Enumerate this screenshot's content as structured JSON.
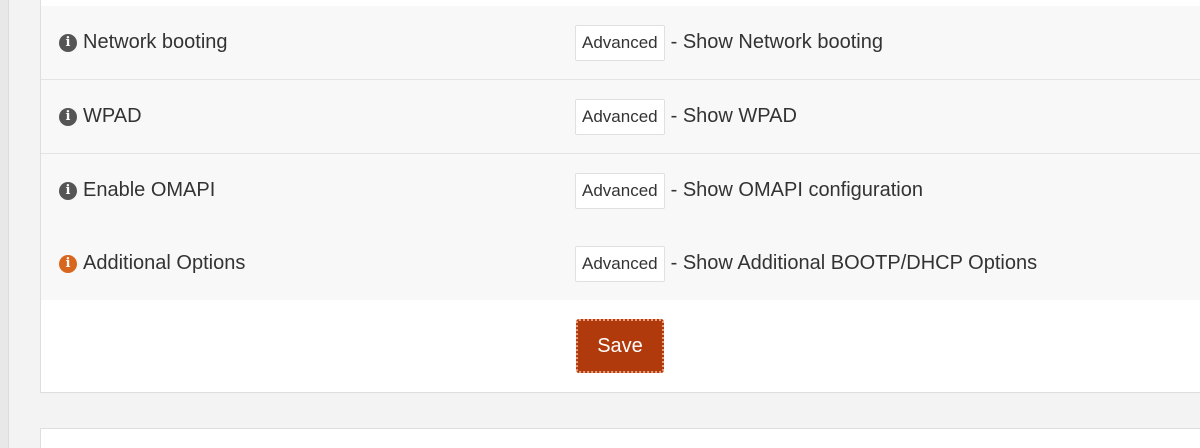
{
  "rows": [
    {
      "label": "Network booting",
      "button": "Advanced",
      "description": "- Show Network booting",
      "icon": "info-icon",
      "icon_color": "#555555"
    },
    {
      "label": "WPAD",
      "button": "Advanced",
      "description": "- Show WPAD",
      "icon": "info-icon",
      "icon_color": "#555555"
    },
    {
      "label": "Enable OMAPI",
      "button": "Advanced",
      "description": "- Show OMAPI configuration",
      "icon": "info-icon",
      "icon_color": "#555555"
    },
    {
      "label": "Additional Options",
      "button": "Advanced",
      "description": "- Show Additional BOOTP/DHCP Options",
      "icon": "info-icon",
      "icon_color": "#d9661f"
    }
  ],
  "save_label": "Save",
  "colors": {
    "save_button": "#b03a0c",
    "accent_icon": "#d9661f"
  }
}
